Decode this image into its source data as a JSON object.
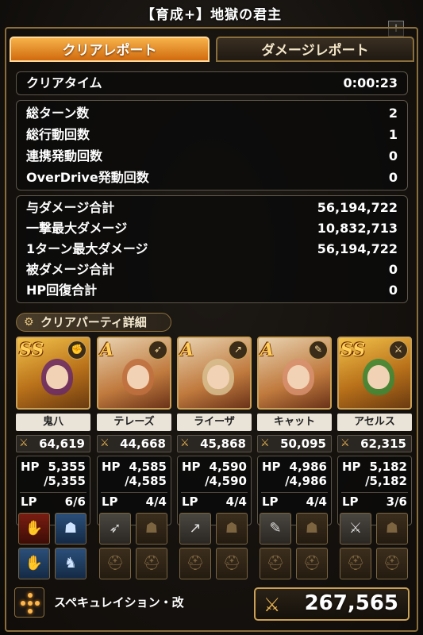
{
  "header": {
    "title": "【育成+】地獄の君主",
    "plus_button": "+"
  },
  "tabs": {
    "active": "クリアレポート",
    "inactive": "ダメージレポート"
  },
  "clear_time": {
    "label": "クリアタイム",
    "value": "0:00:23"
  },
  "counts": [
    {
      "label": "総ターン数",
      "value": "2"
    },
    {
      "label": "総行動回数",
      "value": "1"
    },
    {
      "label": "連携発動回数",
      "value": "0"
    },
    {
      "label": "OverDrive発動回数",
      "value": "0"
    }
  ],
  "damage": [
    {
      "label": "与ダメージ合計",
      "value": "56,194,722"
    },
    {
      "label": "一撃最大ダメージ",
      "value": "10,832,713"
    },
    {
      "label": "1ターン最大ダメージ",
      "value": "56,194,722"
    },
    {
      "label": "被ダメージ合計",
      "value": "0"
    },
    {
      "label": "HP回復合計",
      "value": "0"
    }
  ],
  "party": {
    "header": "クリアパーティ詳細",
    "members": [
      {
        "rank": "SS",
        "name": "鬼八",
        "power": "64,619",
        "hp_label": "HP",
        "hp": "5,355",
        "hp_max": "/5,355",
        "lp_label": "LP",
        "lp": "6/6",
        "face_color": "#6a2a6a",
        "equip_style": "gear",
        "weapon_icon": "fist-icon"
      },
      {
        "rank": "A",
        "name": "テレーズ",
        "power": "44,668",
        "hp_label": "HP",
        "hp": "4,585",
        "hp_max": "/4,585",
        "lp_label": "LP",
        "lp": "4/4",
        "face_color": "#c07040",
        "equip_style": "empty",
        "weapon_icon": "bow-icon"
      },
      {
        "rank": "A",
        "name": "ライーザ",
        "power": "45,868",
        "hp_label": "HP",
        "hp": "4,590",
        "hp_max": "/4,590",
        "lp_label": "LP",
        "lp": "4/4",
        "face_color": "#d8c090",
        "equip_style": "empty",
        "weapon_icon": "lance-icon"
      },
      {
        "rank": "A",
        "name": "キャット",
        "power": "50,095",
        "hp_label": "HP",
        "hp": "4,986",
        "hp_max": "/4,986",
        "lp_label": "LP",
        "lp": "4/4",
        "face_color": "#d89070",
        "equip_style": "empty",
        "weapon_icon": "dagger-icon"
      },
      {
        "rank": "SS",
        "name": "アセルス",
        "power": "62,315",
        "hp_label": "HP",
        "hp": "5,182",
        "hp_max": "/5,182",
        "lp_label": "LP",
        "lp": "3/6",
        "face_color": "#3a8a3a",
        "equip_style": "empty",
        "weapon_icon": "sword-icon"
      }
    ]
  },
  "formation": {
    "name": "スペキュレイション・改"
  },
  "total_power": {
    "value": "267,565"
  },
  "colors": {
    "accent_orange": "#e8891f",
    "gold_border": "#c9a055"
  }
}
